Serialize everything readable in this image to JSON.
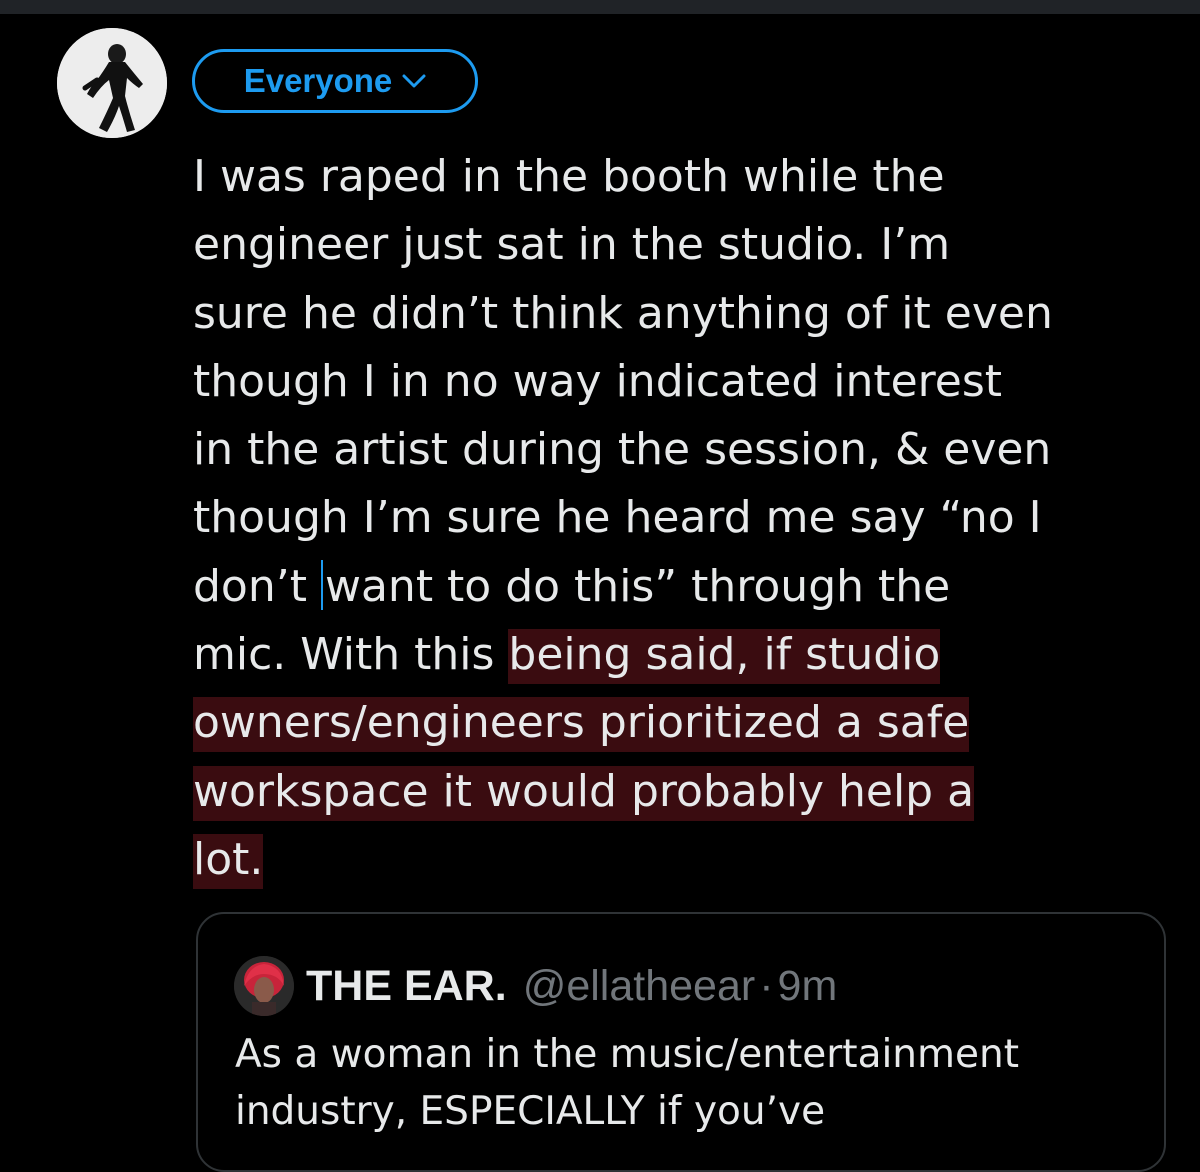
{
  "compose": {
    "audience_label": "Everyone",
    "lines": [
      {
        "plain": "I was raped in the booth while the",
        "highlight": ""
      },
      {
        "plain": "engineer just sat in the studio. I’m",
        "highlight": ""
      },
      {
        "plain": "sure he didn’t think anything of it even",
        "highlight": ""
      },
      {
        "plain": "though I in no way indicated interest",
        "highlight": ""
      },
      {
        "plain": "in the artist during the session, & even",
        "highlight": ""
      },
      {
        "plain": "though I’m sure he heard me say “no I",
        "highlight": ""
      },
      {
        "before_cursor": "don’t",
        "after_cursor": "want to do this” through the"
      },
      {
        "plain": "mic. With this ",
        "highlight": "being said, if studio"
      },
      {
        "plain": "",
        "highlight": "owners/engineers prioritized a safe"
      },
      {
        "plain": "",
        "highlight": "workspace it would probably help a"
      },
      {
        "plain": "",
        "highlight": "lot."
      }
    ],
    "highlight_color": "#3a0c10",
    "cursor_color": "#1d9bf0"
  },
  "quote": {
    "display_name": "THE EAR.",
    "handle": "@ellatheear",
    "separator": "·",
    "time": "9m",
    "text_lines": [
      "As a woman in the music/entertainment",
      "industry, ESPECIALLY if you’ve"
    ]
  },
  "colors": {
    "background": "#000000",
    "accent": "#1d9bf0",
    "text": "#e7e9ea",
    "muted": "#71767b",
    "border": "#2f3336"
  }
}
